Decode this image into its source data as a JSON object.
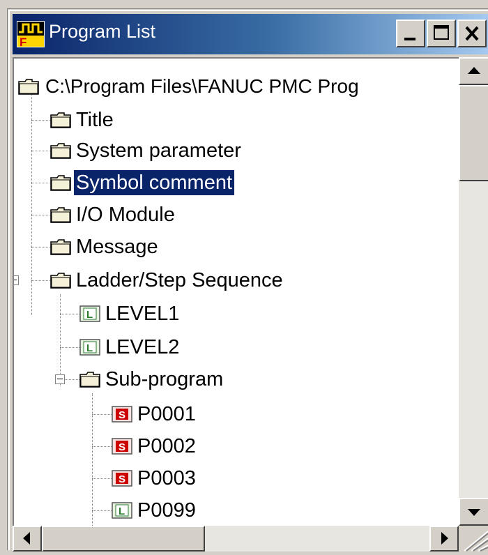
{
  "window": {
    "title": "Program List",
    "caption_buttons": [
      "minimize",
      "maximize",
      "close"
    ]
  },
  "tree": {
    "root_label": "C:\\Program Files\\FANUC PMC Prog",
    "items": [
      {
        "label": "Title",
        "icon": "folder-icon"
      },
      {
        "label": "System parameter",
        "icon": "folder-icon"
      },
      {
        "label": "Symbol comment",
        "icon": "folder-icon",
        "selected": true
      },
      {
        "label": "I/O Module",
        "icon": "folder-icon"
      },
      {
        "label": "Message",
        "icon": "folder-icon"
      },
      {
        "label": "Ladder/Step Sequence",
        "icon": "folder-icon",
        "expanded": true
      }
    ],
    "ladder_children": [
      {
        "label": "LEVEL1",
        "icon": "ladder-icon",
        "badge": "L"
      },
      {
        "label": "LEVEL2",
        "icon": "ladder-icon",
        "badge": "L"
      },
      {
        "label": "Sub-program",
        "icon": "folder-icon",
        "expanded": true
      }
    ],
    "subprogram_children": [
      {
        "label": "P0001",
        "icon": "subprogram-icon",
        "badge": "S"
      },
      {
        "label": "P0002",
        "icon": "subprogram-icon",
        "badge": "S"
      },
      {
        "label": "P0003",
        "icon": "subprogram-icon",
        "badge": "S"
      },
      {
        "label": "P0099",
        "icon": "ladder-icon",
        "badge": "L"
      }
    ]
  },
  "colors": {
    "titlebar_start": "#0a246a",
    "titlebar_end": "#a6caf0",
    "selection": "#0a246a",
    "ladder_badge": "#2e7d32",
    "subprogram_badge": "#cc0000"
  }
}
